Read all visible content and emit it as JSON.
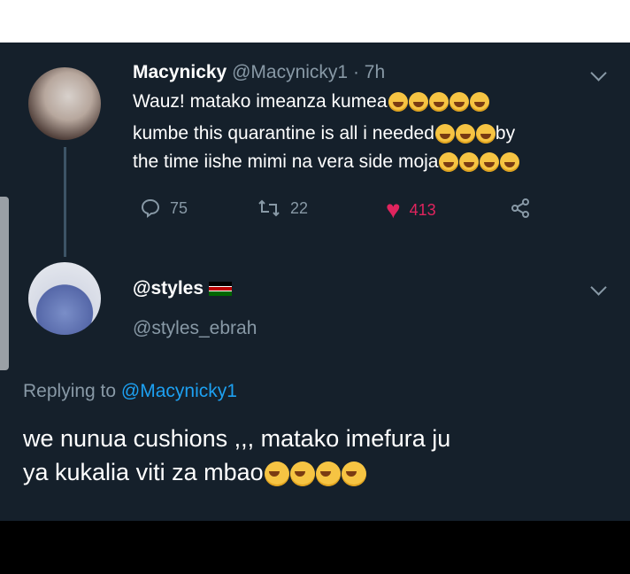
{
  "tweet1": {
    "display_name": "Macynicky",
    "handle": "@Macynicky1",
    "time": "· 7h",
    "line1": "Wauz! matako imeanza kumea",
    "line2": "kumbe this quarantine is all i needed",
    "line2_end": "by",
    "line3": "the time iishe mimi na vera  side moja",
    "replies": "75",
    "retweets": "22",
    "likes": "413",
    "colors": {
      "like": "#e0245e",
      "meta": "#8899a6"
    }
  },
  "tweet2": {
    "display_name": "@styles",
    "handle": "@styles_ebrah",
    "replying_prefix": "Replying to",
    "replying_to": "@Macynicky1",
    "text_line1": "we nunua cushions ,,, matako imefura ju",
    "text_line2": "ya kukalia viti za mbao"
  },
  "icons": [
    "reply-icon",
    "retweet-icon",
    "heart-icon",
    "share-icon",
    "chevron-down-icon",
    "kenya-flag-icon"
  ],
  "colors": {
    "background": "#15202b",
    "link": "#1da1f2"
  }
}
